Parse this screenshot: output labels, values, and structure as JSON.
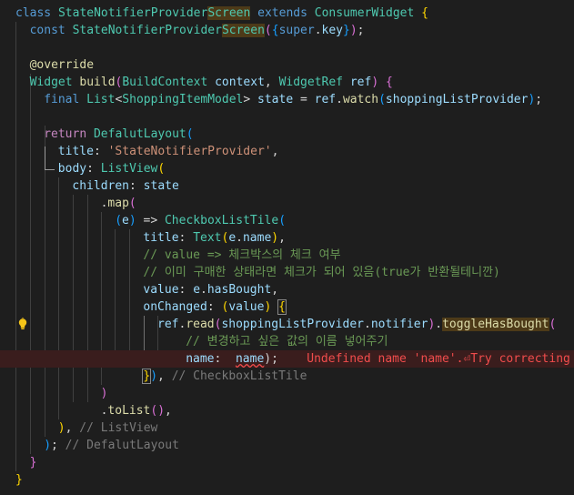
{
  "editor": {
    "lines": [
      {
        "indent": 0,
        "tokens": [
          [
            "kw",
            "class "
          ],
          [
            "cls",
            "StateNotifierProvider"
          ],
          [
            "cls hlw",
            "Screen"
          ],
          [
            "pun",
            " "
          ],
          [
            "kw",
            "extends "
          ],
          [
            "cls",
            "ConsumerWidget "
          ],
          [
            "br1",
            "{"
          ]
        ]
      },
      {
        "indent": 1,
        "tokens": [
          [
            "kw",
            "const "
          ],
          [
            "cls",
            "StateNotifierProvider"
          ],
          [
            "cls hlw",
            "Screen"
          ],
          [
            "br2",
            "("
          ],
          [
            "br3",
            "{"
          ],
          [
            "kw",
            "super"
          ],
          [
            "pun",
            "."
          ],
          [
            "var",
            "key"
          ],
          [
            "br3",
            "}"
          ],
          [
            "br2",
            ")"
          ],
          [
            "pun",
            ";"
          ]
        ]
      },
      {
        "indent": 0,
        "tokens": []
      },
      {
        "indent": 1,
        "tokens": [
          [
            "dec",
            "@override"
          ]
        ]
      },
      {
        "indent": 1,
        "tokens": [
          [
            "cls",
            "Widget "
          ],
          [
            "fn",
            "build"
          ],
          [
            "br2",
            "("
          ],
          [
            "cls",
            "BuildContext "
          ],
          [
            "var",
            "context"
          ],
          [
            "pun",
            ", "
          ],
          [
            "cls",
            "WidgetRef "
          ],
          [
            "var",
            "ref"
          ],
          [
            "br2",
            ")"
          ],
          [
            "pun",
            " "
          ],
          [
            "br2",
            "{"
          ]
        ]
      },
      {
        "indent": 2,
        "tokens": [
          [
            "kw",
            "final "
          ],
          [
            "cls",
            "List"
          ],
          [
            "pun",
            "<"
          ],
          [
            "cls",
            "ShoppingItemModel"
          ],
          [
            "pun",
            "> "
          ],
          [
            "var",
            "state"
          ],
          [
            "pun",
            " = "
          ],
          [
            "var",
            "ref"
          ],
          [
            "pun",
            "."
          ],
          [
            "fn",
            "watch"
          ],
          [
            "br3",
            "("
          ],
          [
            "var",
            "shoppingListProvider"
          ],
          [
            "br3",
            ")"
          ],
          [
            "pun",
            ";"
          ]
        ]
      },
      {
        "indent": 0,
        "tokens": []
      },
      {
        "indent": 2,
        "tokens": [
          [
            "ctl",
            "return "
          ],
          [
            "cls",
            "DefalutLayout"
          ],
          [
            "br3",
            "("
          ]
        ]
      },
      {
        "indent": 3,
        "tokens": [
          [
            "var",
            "title"
          ],
          [
            "pun",
            ": "
          ],
          [
            "str",
            "'StateNotifierProvider'"
          ],
          [
            "pun",
            ","
          ]
        ]
      },
      {
        "indent": 3,
        "tokens": [
          [
            "var",
            "body"
          ],
          [
            "pun",
            ": "
          ],
          [
            "cls",
            "ListView"
          ],
          [
            "br1",
            "("
          ]
        ]
      },
      {
        "indent": 4,
        "tokens": [
          [
            "var",
            "children"
          ],
          [
            "pun",
            ": "
          ],
          [
            "var",
            "state"
          ]
        ]
      },
      {
        "indent": 6,
        "tokens": [
          [
            "pun",
            "."
          ],
          [
            "fn",
            "map"
          ],
          [
            "br2",
            "("
          ]
        ]
      },
      {
        "indent": 7,
        "tokens": [
          [
            "br3",
            "("
          ],
          [
            "var",
            "e"
          ],
          [
            "br3",
            ")"
          ],
          [
            "pun",
            " => "
          ],
          [
            "cls",
            "CheckboxListTile"
          ],
          [
            "br3",
            "("
          ]
        ]
      },
      {
        "indent": 9,
        "tokens": [
          [
            "var",
            "title"
          ],
          [
            "pun",
            ": "
          ],
          [
            "cls",
            "Text"
          ],
          [
            "br1",
            "("
          ],
          [
            "var",
            "e"
          ],
          [
            "pun",
            "."
          ],
          [
            "var",
            "name"
          ],
          [
            "br1",
            ")"
          ],
          [
            "pun",
            ","
          ]
        ]
      },
      {
        "indent": 9,
        "tokens": [
          [
            "cm",
            "// value => 체크박스의 체크 여부"
          ]
        ]
      },
      {
        "indent": 9,
        "tokens": [
          [
            "cm",
            "// 이미 구매한 상태라면 체크가 되어 있음(true가 반환될테니깐)"
          ]
        ]
      },
      {
        "indent": 9,
        "tokens": [
          [
            "var",
            "value"
          ],
          [
            "pun",
            ": "
          ],
          [
            "var",
            "e"
          ],
          [
            "pun",
            "."
          ],
          [
            "var",
            "hasBought"
          ],
          [
            "pun",
            ","
          ]
        ]
      },
      {
        "indent": 9,
        "tokens": [
          [
            "var",
            "onChanged"
          ],
          [
            "pun",
            ": "
          ],
          [
            "br1",
            "("
          ],
          [
            "var",
            "value"
          ],
          [
            "br1",
            ")"
          ],
          [
            "pun",
            " "
          ],
          [
            "br1 bracket-match",
            "{"
          ]
        ]
      },
      {
        "indent": 10,
        "tokens": [
          [
            "var",
            "ref"
          ],
          [
            "pun",
            "."
          ],
          [
            "fn",
            "read"
          ],
          [
            "br2",
            "("
          ],
          [
            "var",
            "shoppingListProvider"
          ],
          [
            "pun",
            "."
          ],
          [
            "var",
            "notifier"
          ],
          [
            "br2",
            ")"
          ],
          [
            "pun",
            "."
          ],
          [
            "fn hlw",
            "toggleHasBought"
          ],
          [
            "br2",
            "("
          ]
        ]
      },
      {
        "indent": 12,
        "tokens": [
          [
            "cm",
            "// 변경하고 싶은 값의 이름 넣어주기"
          ]
        ]
      },
      {
        "indent": 12,
        "tokens": [
          [
            "var",
            "name"
          ],
          [
            "pun",
            ":  "
          ],
          [
            "var squiggle",
            "name"
          ],
          [
            "pun",
            ");"
          ],
          [
            "pun",
            "    "
          ],
          [
            "err-msg",
            "Undefined name 'name'."
          ],
          [
            "err-icon",
            "⏎"
          ],
          [
            "err-msg",
            "Try correcting the name"
          ]
        ],
        "error": true
      },
      {
        "indent": 9,
        "tokens": [
          [
            "br1 bracket-match",
            "}"
          ],
          [
            "br3",
            ")"
          ],
          [
            "pun",
            ", "
          ],
          [
            "ghost",
            "// CheckboxListTile"
          ]
        ]
      },
      {
        "indent": 6,
        "tokens": [
          [
            "br2",
            ")"
          ]
        ]
      },
      {
        "indent": 6,
        "tokens": [
          [
            "pun",
            "."
          ],
          [
            "fn",
            "toList"
          ],
          [
            "br2",
            "()"
          ],
          [
            "pun",
            ","
          ]
        ]
      },
      {
        "indent": 3,
        "tokens": [
          [
            "br1",
            ")"
          ],
          [
            "pun",
            ", "
          ],
          [
            "ghost",
            "// ListView"
          ]
        ]
      },
      {
        "indent": 2,
        "tokens": [
          [
            "br3",
            ")"
          ],
          [
            "pun",
            "; "
          ],
          [
            "ghost",
            "// DefalutLayout"
          ]
        ]
      },
      {
        "indent": 1,
        "tokens": [
          [
            "br2",
            "}"
          ]
        ]
      },
      {
        "indent": 0,
        "tokens": [
          [
            "br1",
            "}"
          ]
        ]
      }
    ],
    "lightbulb_line": 18,
    "colors": {
      "background": "#1e1e1e",
      "error_line_bg": "#3a1d1d",
      "error": "#f14c4c",
      "lightbulb": "#f5c518"
    },
    "icons": [
      "lightbulb-icon"
    ]
  }
}
